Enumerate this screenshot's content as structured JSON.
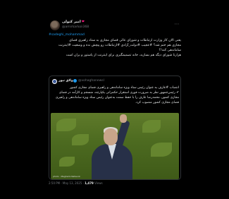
{
  "tweet": {
    "display_name": "امیر کتولی",
    "handle": "@amirkarkoii368",
    "hashtag_line": "#sadeghi_mohammad",
    "body_lines": [
      "یعنی الان کار وزارت ارتباطات و شورای عالی فضای مجازی به ستاد راهبری فضای",
      "مجازی هم ختم شد؟ #عجیب #دولت_آزادی #ارتباطات رو پیچش نده و وضعیت #اینترنت",
      "ساماندهی کنه!؟",
      "هزارتا شورای دیگه هم بسازید، خانه تصمیمگیری برای اینترنت از پاستور و یران است"
    ]
  },
  "quote": {
    "name": "ولاق نیوز",
    "handle": "@vohaghanewsl",
    "lines": [
      "انتصاب #عارف به عنوان رئیس ستاد ویژه ساماندهی و راهبری فضای مجازی کشور",
      "✔ رئیس‌جمهور نظر به ضرورت فوری استقرار حکمرانی یکپارچه، منسجم و کارآمد در فضای",
      "مجازی کشور، محمدرضا عارف را با حفظ سمت به‌عنوان رئیس ستاد ویژه ساماندهی و راهبری",
      "فضای مجازی کشور منصوب کرد."
    ],
    "photo_credit": "photo · Maghami Network"
  },
  "meta": {
    "time": "2:50 PM · May 13, 2025",
    "views": "1,479",
    "views_label": "Views"
  }
}
